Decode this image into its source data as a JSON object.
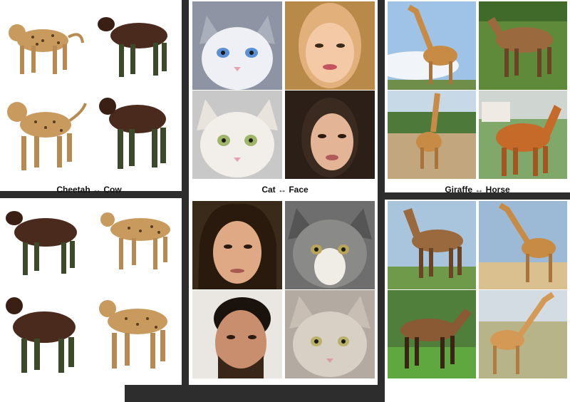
{
  "labels": {
    "animals_top": "Cheetah ↔ Cow",
    "faces_top": "Cat ↔ Face",
    "horse_giraffe_top": "Giraffe ↔ Horse",
    "animals_bottom": "",
    "faces_bottom": "",
    "horse_giraffe_bottom": ""
  },
  "colors": {
    "divider": "#2d2d2d",
    "cheetah": "#c99a5e",
    "cow": "#4a2a1c",
    "sky": "#9fc3e6",
    "grass": "#5f8a3a"
  }
}
